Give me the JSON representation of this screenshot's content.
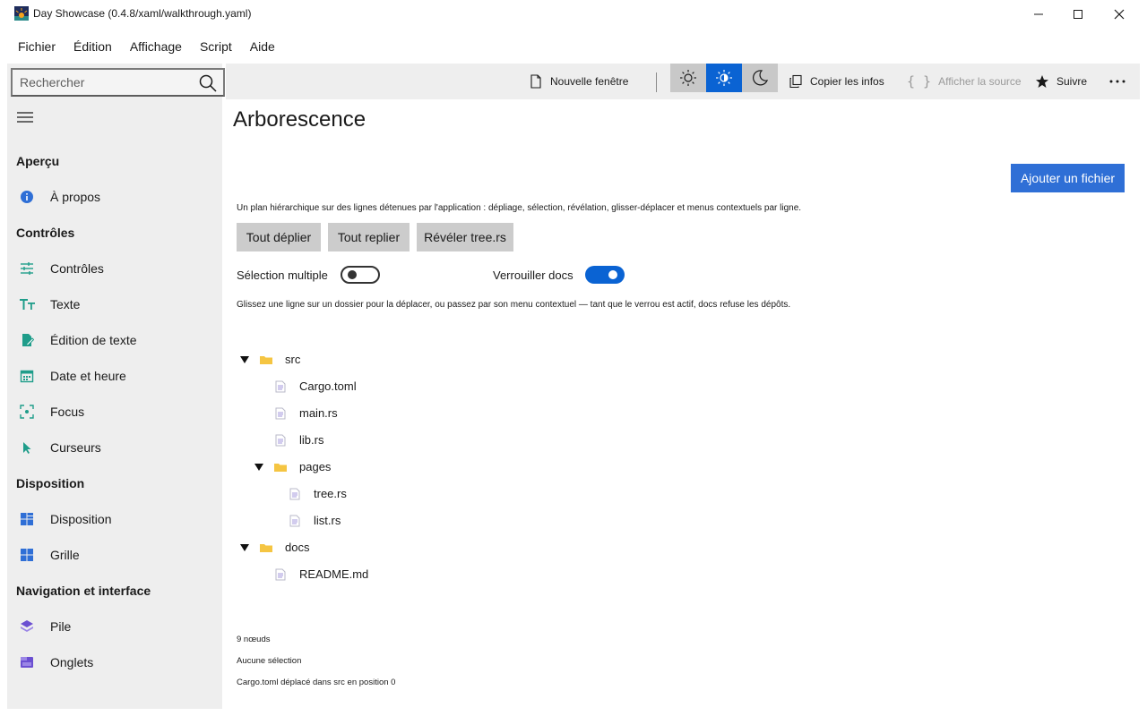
{
  "window": {
    "title": "Day Showcase (0.4.8/xaml/walkthrough.yaml)"
  },
  "menu": [
    "Fichier",
    "Édition",
    "Affichage",
    "Script",
    "Aide"
  ],
  "search": {
    "placeholder": "Rechercher",
    "value": ""
  },
  "sidebar": {
    "sections": [
      {
        "title": "Aperçu",
        "items": [
          {
            "label": "À propos",
            "icon": "info-icon"
          }
        ]
      },
      {
        "title": "Contrôles",
        "items": [
          {
            "label": "Contrôles",
            "icon": "sliders-icon"
          },
          {
            "label": "Texte",
            "icon": "text-size-icon"
          },
          {
            "label": "Édition de texte",
            "icon": "edit-document-icon"
          },
          {
            "label": "Date et heure",
            "icon": "calendar-icon"
          },
          {
            "label": "Focus",
            "icon": "focus-icon"
          },
          {
            "label": "Curseurs",
            "icon": "cursor-icon"
          }
        ]
      },
      {
        "title": "Disposition",
        "items": [
          {
            "label": "Disposition",
            "icon": "layout-icon"
          },
          {
            "label": "Grille",
            "icon": "grid-icon"
          }
        ]
      },
      {
        "title": "Navigation et interface",
        "items": [
          {
            "label": "Pile",
            "icon": "stack-icon"
          },
          {
            "label": "Onglets",
            "icon": "tabs-icon"
          }
        ]
      }
    ]
  },
  "toolbar": {
    "new_window": "Nouvelle fenêtre",
    "copy_info": "Copier les infos",
    "show_source": "Afficher la source",
    "follow": "Suivre",
    "theme_selected": "system"
  },
  "page": {
    "title": "Arborescence",
    "add_file": "Ajouter un fichier",
    "description": "Un plan hiérarchique sur des lignes détenues par l'application : dépliage, sélection, révélation, glisser-déplacer et menus contextuels par ligne.",
    "buttons": {
      "expand_all": "Tout déplier",
      "collapse_all": "Tout replier",
      "reveal": "Révéler tree.rs"
    },
    "multi_select": {
      "label": "Sélection multiple",
      "on": false
    },
    "lock_docs": {
      "label": "Verrouiller docs",
      "on": true
    },
    "hint": "Glissez une ligne sur un dossier pour la déplacer, ou passez par son menu contextuel — tant que le verrou est actif, docs refuse les dépôts.",
    "tree": [
      {
        "label": "src",
        "type": "folder",
        "depth": 0,
        "expanded": true
      },
      {
        "label": "Cargo.toml",
        "type": "file",
        "depth": 1
      },
      {
        "label": "main.rs",
        "type": "file",
        "depth": 1
      },
      {
        "label": "lib.rs",
        "type": "file",
        "depth": 1
      },
      {
        "label": "pages",
        "type": "folder",
        "depth": 1,
        "expanded": true
      },
      {
        "label": "tree.rs",
        "type": "file",
        "depth": 2
      },
      {
        "label": "list.rs",
        "type": "file",
        "depth": 2
      },
      {
        "label": "docs",
        "type": "folder",
        "depth": 0,
        "expanded": true
      },
      {
        "label": "README.md",
        "type": "file",
        "depth": 1
      }
    ],
    "status": {
      "count": "9 nœuds",
      "selection": "Aucune sélection",
      "last_action": "Cargo.toml déplacé dans src en position 0"
    }
  },
  "colors": {
    "accent": "#2f6fd6",
    "toggle_on": "#0a63d3",
    "folder": "#f5c542",
    "sidebar_bg": "#eeeeee"
  }
}
